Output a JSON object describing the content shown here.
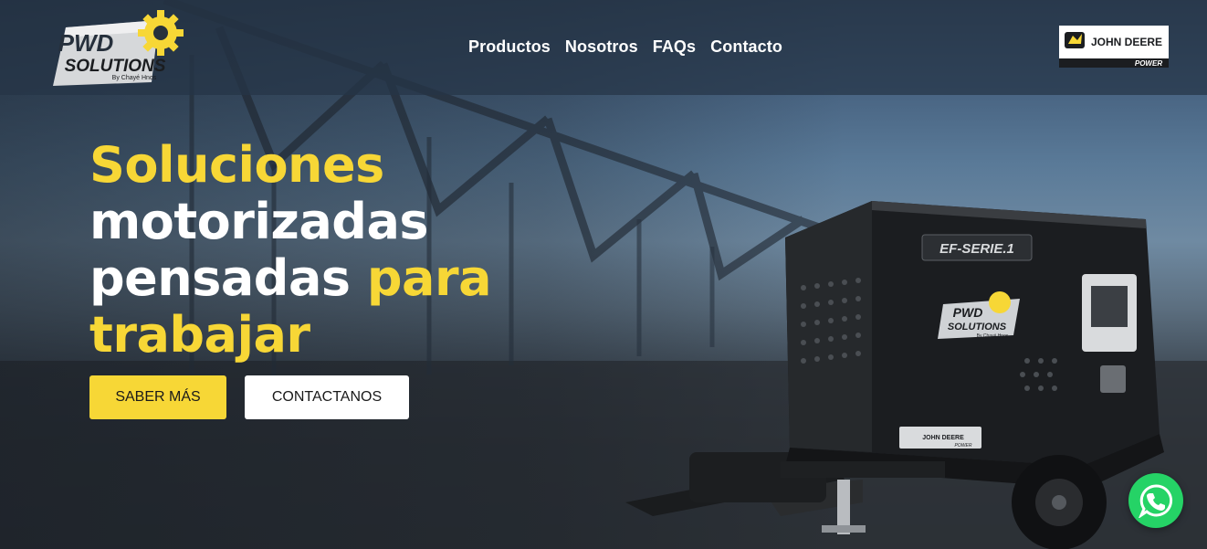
{
  "brand": {
    "logo_line1": "PWD",
    "logo_line2": "SOLUTIONS",
    "logo_tagline": "By Chayé Hnos",
    "accent": "#f7d736",
    "partner_logo_text": "JOHN DEERE",
    "partner_logo_sub": "POWER"
  },
  "nav": {
    "items": [
      "Productos",
      "Nosotros",
      "FAQs",
      "Contacto"
    ]
  },
  "hero": {
    "headline_line1": "Soluciones",
    "headline_line2": "motorizadas",
    "headline_line3a": "pensadas",
    "headline_line3b": "para",
    "headline_line4": "trabajar",
    "primary_button": "SABER MÁS",
    "secondary_button": "CONTACTANOS"
  },
  "product": {
    "model_plate": "EF-SERIE.1",
    "logo_line1": "PWD",
    "logo_line2": "SOLUTIONS",
    "logo_tagline": "By Chayé Hnos",
    "deere_text": "JOHN DEERE",
    "deere_sub": "POWER"
  },
  "chat": {
    "icon": "whatsapp-icon"
  }
}
